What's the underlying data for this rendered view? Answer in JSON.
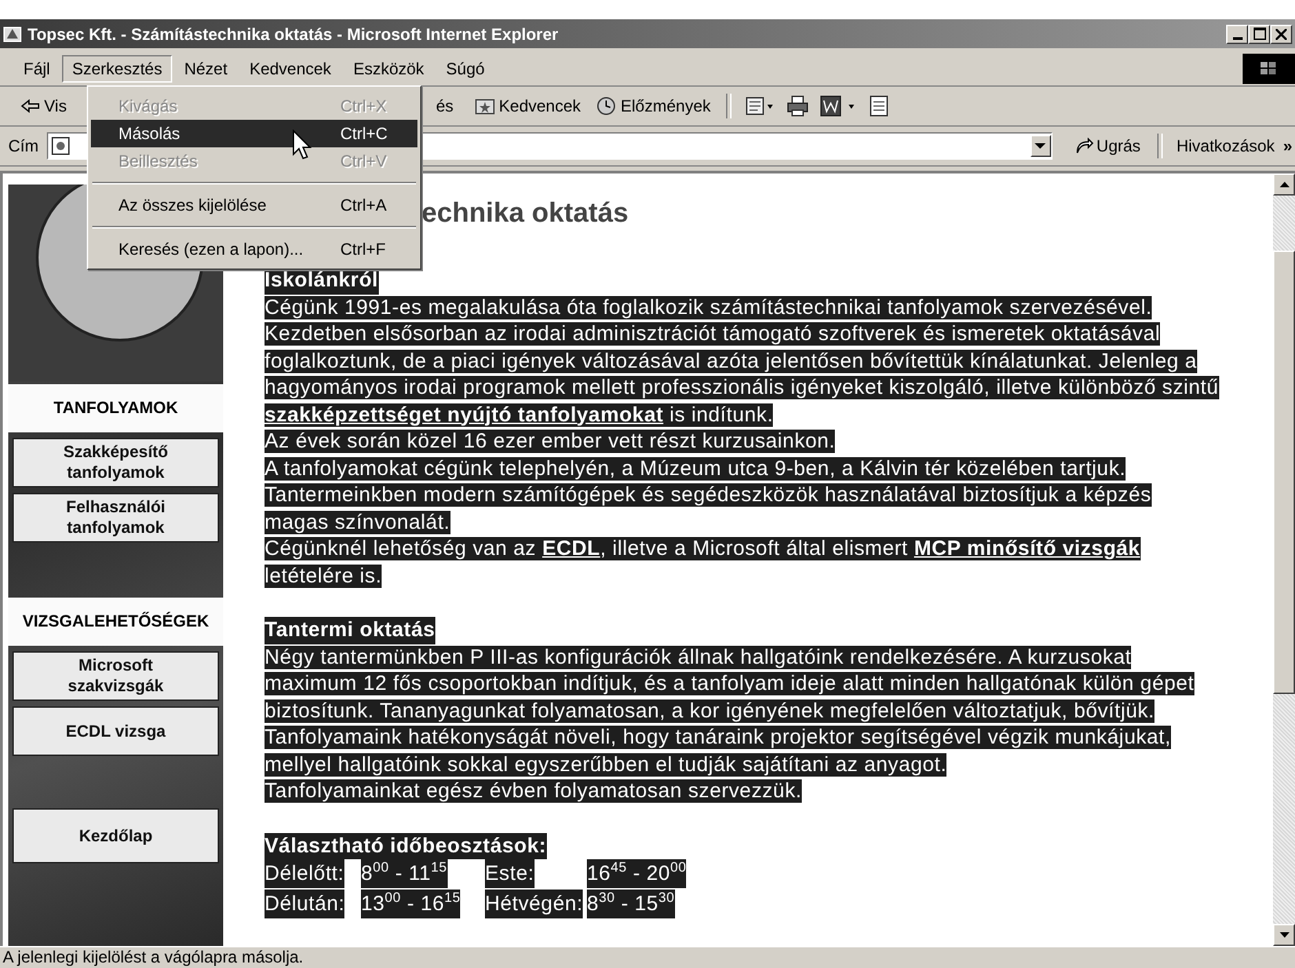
{
  "window": {
    "title": "Topsec Kft. - Számítástechnika oktatás - Microsoft Internet Explorer"
  },
  "menu_bar": [
    {
      "label": "Fájl",
      "selected": false
    },
    {
      "label": "Szerkesztés",
      "selected": true
    },
    {
      "label": "Nézet",
      "selected": false
    },
    {
      "label": "Kedvencek",
      "selected": false
    },
    {
      "label": "Eszközök",
      "selected": false
    },
    {
      "label": "Súgó",
      "selected": false
    }
  ],
  "edit_menu": [
    {
      "kind": "item",
      "label": "Kivágás",
      "shortcut": "Ctrl+X",
      "disabled": true,
      "selected": false
    },
    {
      "kind": "item",
      "label": "Másolás",
      "shortcut": "Ctrl+C",
      "disabled": false,
      "selected": true
    },
    {
      "kind": "item",
      "label": "Beillesztés",
      "shortcut": "Ctrl+V",
      "disabled": true,
      "selected": false
    },
    {
      "kind": "separator"
    },
    {
      "kind": "item",
      "label": "Az összes kijelölése",
      "shortcut": "Ctrl+A",
      "disabled": false,
      "selected": false
    },
    {
      "kind": "separator"
    },
    {
      "kind": "item",
      "label": "Keresés (ezen a lapon)...",
      "shortcut": "Ctrl+F",
      "disabled": false,
      "selected": false
    }
  ],
  "toolbar": [
    {
      "kind": "back",
      "label": "Vis"
    },
    {
      "kind": "search",
      "label": "és"
    },
    {
      "kind": "favorites",
      "label": "Kedvencek"
    },
    {
      "kind": "history",
      "label": "Előzmények"
    }
  ],
  "address_bar": {
    "label": "Cím",
    "go": "Ugrás",
    "links": "Hivatkozások",
    "more": "»"
  },
  "sidebar": {
    "sections": [
      {
        "heading": "TANFOLYAMOK",
        "links": [
          "Szakképesítő tanfolyamok",
          "Felhasználói tanfolyamok"
        ]
      },
      {
        "heading": "VIZSGALEHETŐSÉGEK",
        "links": [
          "Microsoft szakvizsgák",
          "ECDL vizsga"
        ]
      }
    ],
    "home": "Kezdőlap"
  },
  "content": {
    "heading": "echnika oktatás",
    "sections": [
      {
        "title": "Iskolánkról",
        "lines": [
          [
            {
              "text": "Cégünk 1991-es megalakulása óta foglalkozik számítástechnikai tanfolyamok szervezésével.",
              "link": false
            }
          ],
          [
            {
              "text": "Kezdetben elsősorban az irodai adminisztrációt támogató szoftverek és ismeretek oktatásával",
              "link": false
            }
          ],
          [
            {
              "text": "foglalkoztunk, de a piaci igények változásával azóta jelentősen  bővítettük kínálatunkat. Jelenleg a",
              "link": false
            }
          ],
          [
            {
              "text": "hagyományos irodai programok mellett professzionális igényeket kiszolgáló, illetve különböző szintű",
              "link": false
            }
          ],
          [
            {
              "text": "szakképzettséget nyújtó tanfolyamokat",
              "link": true
            },
            {
              "text": " is indítunk.",
              "link": false
            }
          ],
          [
            {
              "text": "Az évek során közel 16 ezer ember vett részt kurzusainkon.",
              "link": false
            }
          ],
          [
            {
              "text": "A tanfolyamokat cégünk telephelyén, a Múzeum utca 9-ben, a Kálvin tér közelében tartjuk.",
              "link": false
            }
          ],
          [
            {
              "text": "Tantermeinkben modern számítógépek és segédeszközök használatával biztosítjuk a képzés",
              "link": false
            }
          ],
          [
            {
              "text": "magas színvonalát.",
              "link": false
            }
          ],
          [
            {
              "text": "Cégünknél lehetőség van az ",
              "link": false
            },
            {
              "text": "ECDL",
              "link": true
            },
            {
              "text": ", illetve a Microsoft által elismert ",
              "link": false
            },
            {
              "text": "MCP minősítő vizsgák",
              "link": true
            }
          ],
          [
            {
              "text": "letételére is.",
              "link": false
            }
          ]
        ]
      },
      {
        "title": "Tantermi oktatás",
        "lines": [
          [
            {
              "text": "Négy tantermünkben P III-as konfigurációk állnak hallgatóink rendelkezésére. A kurzusokat",
              "link": false
            }
          ],
          [
            {
              "text": "maximum 12 fős csoportokban indítjuk, és a tanfolyam ideje alatt minden hallgatónak külön gépet",
              "link": false
            }
          ],
          [
            {
              "text": "biztosítunk. Tananyagunkat folyamatosan, a kor igényének megfelelően változtatjuk, bővítjük.",
              "link": false
            }
          ],
          [
            {
              "text": "Tanfolyamaink hatékonyságát növeli, hogy tanáraink projektor segítségével végzik munkájukat,",
              "link": false
            }
          ],
          [
            {
              "text": "mellyel hallgatóink sokkal egyszerűbben el tudják sajátítani az anyagot.",
              "link": false
            }
          ],
          [
            {
              "text": "Tanfolyamainkat egész évben folyamatosan szervezzük.",
              "link": false
            }
          ]
        ]
      }
    ],
    "schedule": {
      "title": "Választható időbeosztások:",
      "rows": [
        [
          "Délelőtt:",
          "8$^{00}$ - 11$^{15}$",
          "Este:",
          "16$^{45}$ - 20$^{00}$"
        ],
        [
          "Délután:",
          "13$^{00}$ - 16$^{15}$",
          "Hétvégén:",
          "8$^{30}$ - 15$^{30}$"
        ]
      ]
    }
  },
  "status_bar": "A jelenlegi kijelölést a vágólapra másolja."
}
